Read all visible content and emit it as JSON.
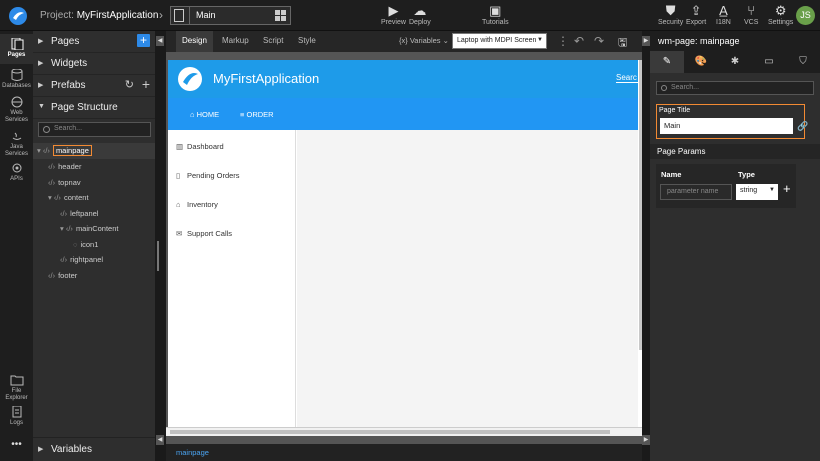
{
  "topbar": {
    "project_label": "Project:",
    "project_name": "MyFirstApplication",
    "page_name": "Main",
    "preview": "Preview",
    "deploy": "Deploy",
    "tutorials": "Tutorials",
    "security": "Security",
    "export": "Export",
    "i18n": "I18N",
    "vcs": "VCS",
    "settings": "Settings",
    "avatar": "JS"
  },
  "leftnav": {
    "pages": "Pages",
    "databases": "Databases",
    "web_services_1": "Web",
    "web_services_2": "Services",
    "java_services_1": "Java",
    "java_services_2": "Services",
    "apis": "APIs",
    "file_explorer_1": "File",
    "file_explorer_2": "Explorer",
    "logs": "Logs",
    "more": "•••"
  },
  "panel": {
    "pages": "Pages",
    "widgets": "Widgets",
    "prefabs": "Prefabs",
    "page_structure": "Page Structure",
    "search_placeholder": "Search...",
    "variables": "Variables",
    "tree": [
      "mainpage",
      "header",
      "topnav",
      "content",
      "leftpanel",
      "mainContent",
      "icon1",
      "rightpanel",
      "footer"
    ]
  },
  "canvasbar": {
    "tabs": [
      "Design",
      "Markup",
      "Script",
      "Style"
    ],
    "variables": "{x} Variables",
    "device": "Laptop with MDPI Screen"
  },
  "app": {
    "title": "MyFirstApplication",
    "search": "Searc",
    "nav_home": "HOME",
    "nav_order": "ORDER",
    "sidebar": [
      "Dashboard",
      "Pending Orders",
      "Inventory",
      "Support Calls"
    ]
  },
  "status": {
    "breadcrumb": "mainpage"
  },
  "rpanel": {
    "title": "wm-page: mainpage",
    "search_placeholder": "Search...",
    "page_title_label": "Page Title",
    "page_title_value": "Main",
    "page_params": "Page Params",
    "col_name": "Name",
    "col_type": "Type",
    "param_placeholder": "parameter name",
    "type_value": "string"
  }
}
